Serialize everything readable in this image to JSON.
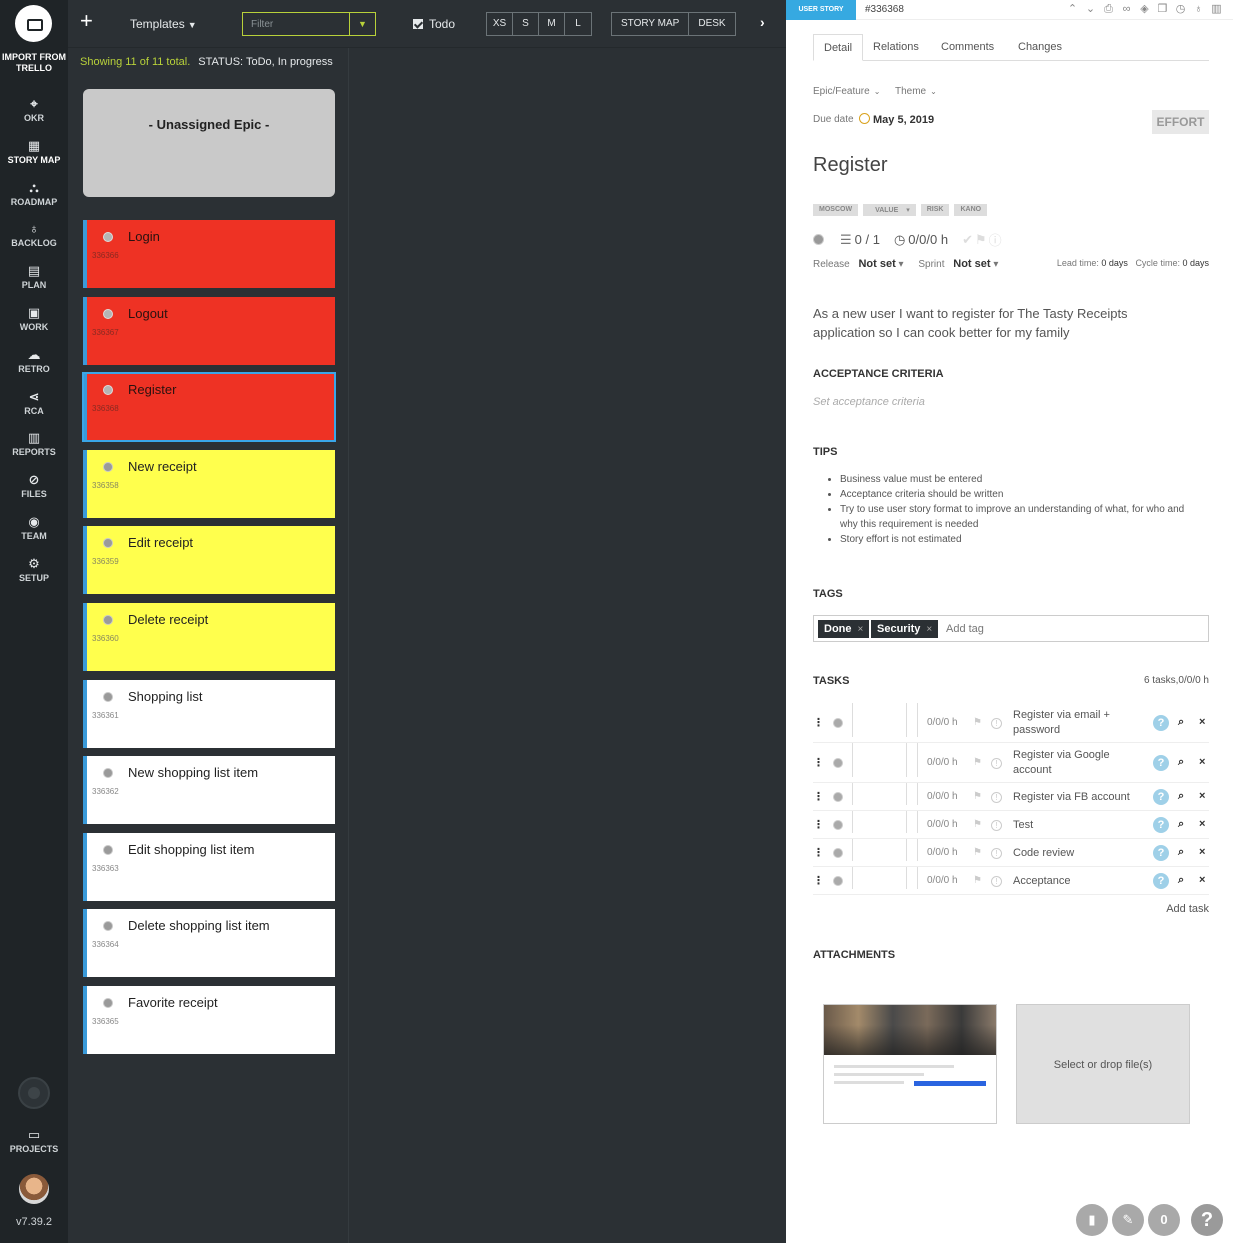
{
  "sidebar": {
    "import_line1": "IMPORT FROM",
    "import_line2": "TRELLO",
    "items": [
      {
        "label": "OKR",
        "icon": "okr-icon"
      },
      {
        "label": "STORY MAP",
        "icon": "grid-icon"
      },
      {
        "label": "ROADMAP",
        "icon": "road-icon"
      },
      {
        "label": "BACKLOG",
        "icon": "bulb-icon"
      },
      {
        "label": "PLAN",
        "icon": "list-icon"
      },
      {
        "label": "WORK",
        "icon": "briefcase-icon"
      },
      {
        "label": "RETRO",
        "icon": "chat-icon"
      },
      {
        "label": "RCA",
        "icon": "share-icon"
      },
      {
        "label": "REPORTS",
        "icon": "bar-chart-icon"
      },
      {
        "label": "FILES",
        "icon": "paperclip-icon"
      },
      {
        "label": "TEAM",
        "icon": "user-circle-icon"
      },
      {
        "label": "SETUP",
        "icon": "gear-icon"
      }
    ],
    "projects_label": "PROJECTS",
    "version": "v7.39.2"
  },
  "toolbar": {
    "add_symbol": "+",
    "templates_label": "Templates",
    "filter_placeholder": "Filter",
    "todo_label": "Todo",
    "sizes": [
      "XS",
      "S",
      "M",
      "L"
    ],
    "views": [
      "STORY MAP",
      "DESK"
    ]
  },
  "status": {
    "count": "Showing 11 of 11 total.",
    "filter": "STATUS: ToDo, In progress"
  },
  "board": {
    "epic_label": "- Unassigned Epic -",
    "cards": [
      {
        "title": "Login",
        "id": "336366",
        "color": "#ee3224"
      },
      {
        "title": "Logout",
        "id": "336367",
        "color": "#ee3224"
      },
      {
        "title": "Register",
        "id": "336368",
        "color": "#ee3224"
      },
      {
        "title": "New receipt",
        "id": "336358",
        "color": "#ffff4d"
      },
      {
        "title": "Edit receipt",
        "id": "336359",
        "color": "#ffff4d"
      },
      {
        "title": "Delete receipt",
        "id": "336360",
        "color": "#ffff4d"
      },
      {
        "title": "Shopping list",
        "id": "336361",
        "color": "#ffffff"
      },
      {
        "title": "New shopping list item",
        "id": "336362",
        "color": "#ffffff"
      },
      {
        "title": "Edit shopping list item",
        "id": "336363",
        "color": "#ffffff"
      },
      {
        "title": "Delete shopping list item",
        "id": "336364",
        "color": "#ffffff"
      },
      {
        "title": "Favorite receipt",
        "id": "336365",
        "color": "#ffffff"
      }
    ]
  },
  "panel": {
    "badge": "USER STORY",
    "item_id": "#336368",
    "tabs": [
      "Detail",
      "Relations",
      "Comments",
      "Changes"
    ],
    "epic_feature": "Epic/Feature",
    "theme": "Theme",
    "due_label": "Due date",
    "due_value": "May 5, 2019",
    "effort": "EFFORT",
    "title": "Register",
    "mini_tags": [
      "MOSCOW",
      "VALUE",
      "RISK",
      "KANO"
    ],
    "checklist": "0 / 1",
    "time": "0/0/0 h",
    "release_label": "Release",
    "release_value": "Not set",
    "sprint_label": "Sprint",
    "sprint_value": "Not set",
    "lead_time_label": "Lead time:",
    "lead_time_value": "0 days",
    "cycle_time_label": "Cycle time:",
    "cycle_time_value": "0 days",
    "description": "As a new user I want to register for The Tasty Receipts application so I can cook better for my family",
    "acceptance_heading": "ACCEPTANCE CRITERIA",
    "acceptance_placeholder": "Set acceptance criteria",
    "tips_heading": "TIPS",
    "tips": [
      "Business value must be entered",
      "Acceptance criteria should be written",
      "Try to use user story format to improve an understanding of what, for who and why this requirement is needed",
      "Story effort is not estimated"
    ],
    "tags_heading": "TAGS",
    "tags": [
      "Done",
      "Security"
    ],
    "add_tag_placeholder": "Add tag",
    "tasks_heading": "TASKS",
    "tasks_summary": "6  tasks,0/0/0 h",
    "tasks": [
      {
        "name": "Register via email + password",
        "hours": "0/0/0 h"
      },
      {
        "name": "Register via Google account",
        "hours": "0/0/0 h"
      },
      {
        "name": "Register via FB account",
        "hours": "0/0/0 h"
      },
      {
        "name": "Test",
        "hours": "0/0/0 h"
      },
      {
        "name": "Code review",
        "hours": "0/0/0 h"
      },
      {
        "name": "Acceptance",
        "hours": "0/0/0 h"
      }
    ],
    "add_task": "Add task",
    "attachments_heading": "ATTACHMENTS",
    "drop_label": "Select or drop file(s)",
    "fab_count": "0",
    "fab_help": "?"
  }
}
